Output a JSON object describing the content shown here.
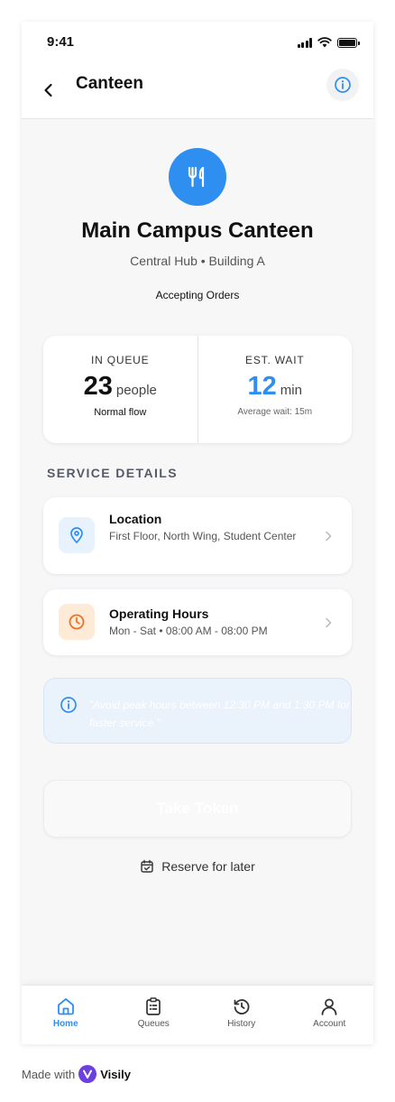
{
  "status_bar": {
    "time": "9:41"
  },
  "header": {
    "title": "Canteen"
  },
  "canteen": {
    "name": "Main Campus Canteen",
    "subtitle": "Central Hub • Building A",
    "status": "Accepting Orders"
  },
  "stats": {
    "queue": {
      "label": "IN QUEUE",
      "value": "23",
      "unit": "people",
      "note": "Normal flow"
    },
    "wait": {
      "label": "EST. WAIT",
      "value": "12",
      "unit": "min",
      "note": "Average wait: 15m"
    }
  },
  "service": {
    "section_title": "SERVICE DETAILS",
    "location": {
      "title": "Location",
      "body": "First Floor, North Wing, Student Center"
    },
    "hours": {
      "title": "Operating Hours",
      "body": "Mon - Sat • 08:00 AM - 08:00 PM"
    }
  },
  "tip": {
    "text": "\"Avoid peak hours between 12:30 PM and 1:30 PM for faster service.\""
  },
  "actions": {
    "take_token": "Take Token",
    "reserve": "Reserve for later"
  },
  "nav": {
    "home": "Home",
    "queues": "Queues",
    "history": "History",
    "account": "Account"
  },
  "footer": {
    "made_with": "Made with",
    "brand": "Visily"
  },
  "colors": {
    "accent": "#2f8ff0",
    "hours_accent": "#e8742a",
    "tip_bg": "#eaf2fc"
  }
}
